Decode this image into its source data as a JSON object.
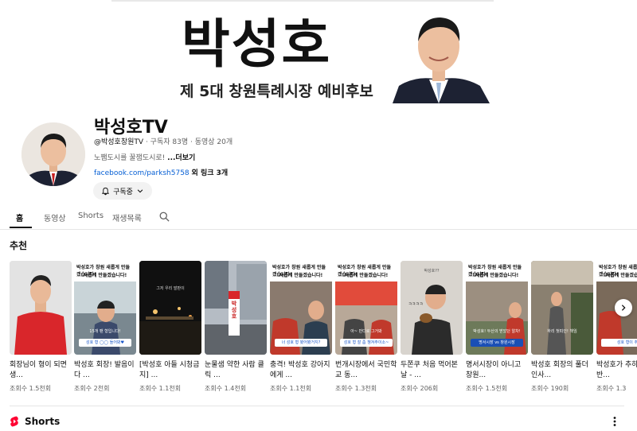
{
  "banner": {
    "name": "박성호",
    "subtitle": "제 5대 창원특례시장 예비후보"
  },
  "channel": {
    "name": "박성호TV",
    "handle": "@박성호창원TV",
    "subscribers": "구독자 83명",
    "video_count": "동영상 20개",
    "description": "노쨈도시를 꿀잼도시로!",
    "description_more": "...더보기",
    "link": "facebook.com/parksh5758",
    "link_more": "외 링크 3개",
    "subscribe_label": "구독중"
  },
  "tabs": [
    {
      "label": "홈",
      "active": true
    },
    {
      "label": "동영상",
      "active": false
    },
    {
      "label": "Shorts",
      "active": false
    },
    {
      "label": "재생목록",
      "active": false
    }
  ],
  "recommended": {
    "title": "추천",
    "cards": [
      {
        "title": "회장님이 형이 되면 생...",
        "views": "조회수 1.5천회"
      },
      {
        "title": "박성호 회장! 발음이 다 ...",
        "views": "조회수 2천회"
      },
      {
        "title": "[박성호 아들 시청금지] ...",
        "views": "조회수 1.1천회"
      },
      {
        "title": "눈물샘 약한 사람 클릭 ...",
        "views": "조회수 1.4천회"
      },
      {
        "title": "충격! 박성호 강아지에게 ...",
        "views": "조회수 1.1천회"
      },
      {
        "title": "번개시장에서 국민학교 동...",
        "views": "조회수 1.3천회"
      },
      {
        "title": "두쫀쿠 처음 먹어본 날 - ...",
        "views": "조회수 206회"
      },
      {
        "title": "명서시장이 아니고 창원...",
        "views": "조회수 1.5천회"
      },
      {
        "title": "박성호 회장의 풀더인사...",
        "views": "조회수 190회"
      },
      {
        "title": "박성호가 추하는 반...",
        "views": "조회수 1.3"
      }
    ],
    "thumb_text": {
      "banner_line1": "박성호가 창원 새롭게 만들겠습니다!",
      "banner_line2": "새롭게 만들겠습니다!",
      "t2_caption": "성호 형 ◯◯ 들어봐♥",
      "t2_sub": "15개 팬 형입니다!",
      "t3_caption": "그저 우리 발판이",
      "t4_sign": "박성호",
      "t5_caption": "너 성호 형 봤어봤거지?",
      "t5_sub": "너 성호 형 봤어봤거지?",
      "t6_caption": "성호 형 잘 좀 챙겨주이소~",
      "t6_sub": "아~ 만디로 그거봐",
      "t7_caption": "ㅋㅋㅋㅋ",
      "t7_top": "박성호??",
      "t8_caption": "명서시장 vs 창원시장",
      "t8_sub": "박성호! 두산의 받았던 알차!",
      "t9_caption": "하리 첫피인! 책임",
      "t10_caption": "성호 형이 추"
    }
  },
  "shorts_section": {
    "title": "Shorts"
  }
}
